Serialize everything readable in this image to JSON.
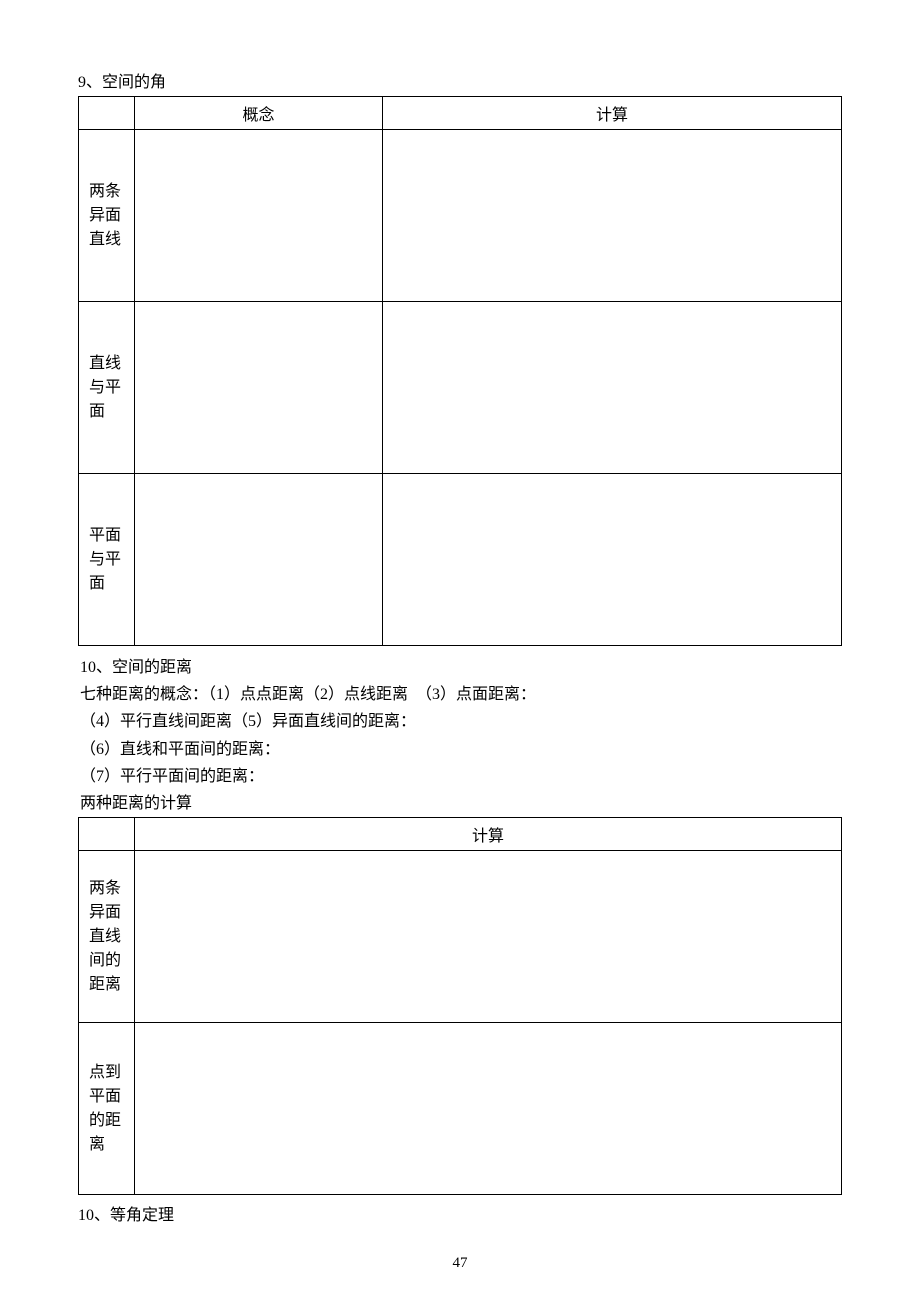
{
  "section9": {
    "title": "9、空间的角",
    "table": {
      "headers": {
        "concept": "概念",
        "calc": "计算"
      },
      "rows": [
        {
          "label": "两条\n异面\n直线",
          "concept": "",
          "calc": ""
        },
        {
          "label": "直线\n与平\n面",
          "concept": "",
          "calc": ""
        },
        {
          "label": "平面\n与平\n面",
          "concept": "",
          "calc": ""
        }
      ]
    }
  },
  "section10": {
    "title": "10、空间的距离",
    "lines": [
      "七种距离的概念：（1）点点距离（2）点线距离　（3）点面距离：",
      "（4）平行直线间距离（5）异面直线间的距离：",
      "（6）直线和平面间的距离：",
      "（7）平行平面间的距离："
    ],
    "subtitle": "两种距离的计算",
    "table": {
      "headers": {
        "calc": "计算"
      },
      "rows": [
        {
          "label": "两条\n异面\n直线\n间的\n距离",
          "calc": ""
        },
        {
          "label": "点到\n平面\n的距\n离",
          "calc": ""
        }
      ]
    }
  },
  "section10b": {
    "title": "10、等角定理"
  },
  "pageNumber": "47"
}
